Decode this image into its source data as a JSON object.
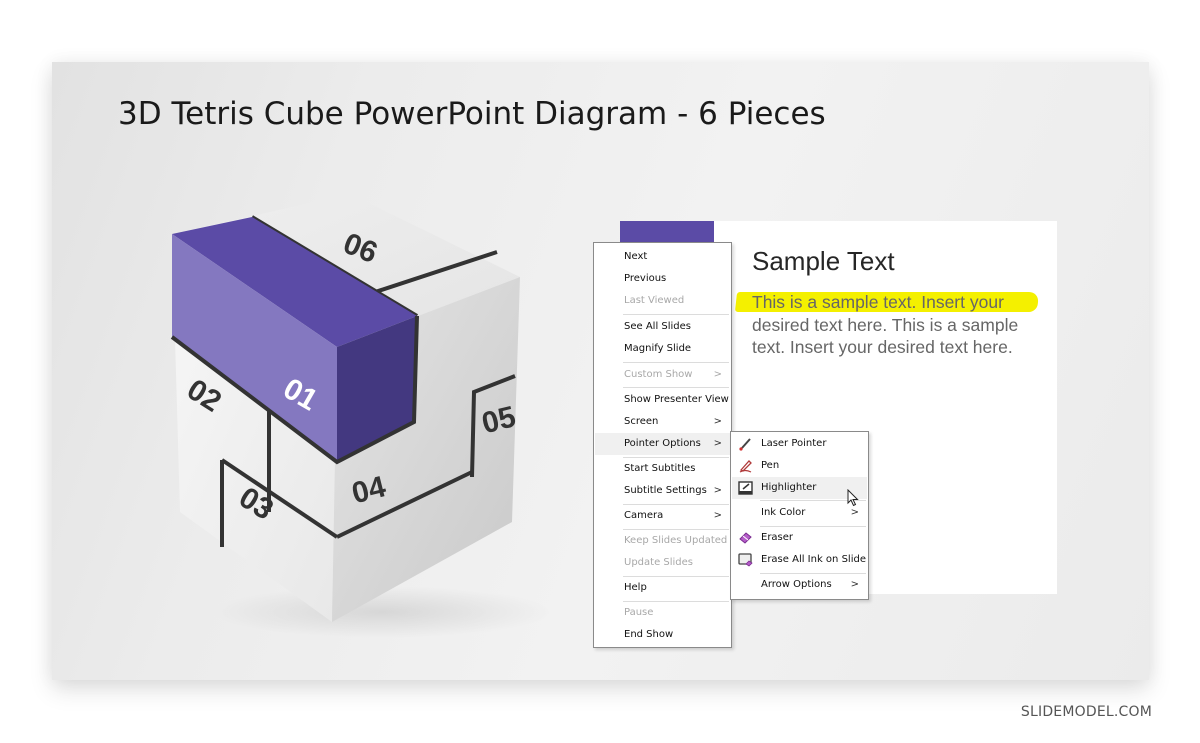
{
  "slide": {
    "title": "3D Tetris Cube PowerPoint Diagram - 6 Pieces",
    "accent_color": "#5b4ba6",
    "cube_pieces": [
      {
        "label": "01",
        "color": "#5b4ba6"
      },
      {
        "label": "02",
        "color": "#eeeeee"
      },
      {
        "label": "03",
        "color": "#eeeeee"
      },
      {
        "label": "04",
        "color": "#eeeeee"
      },
      {
        "label": "05",
        "color": "#eeeeee"
      },
      {
        "label": "06",
        "color": "#eeeeee"
      }
    ],
    "textbox": {
      "heading": "Sample Text",
      "body": "This is a sample text.  Insert your desired text here. This is a sample text.  Insert your desired text here.",
      "highlighted_text": "This is a sample text.  Insert your",
      "highlight_color": "#f4f000"
    }
  },
  "context_menu": {
    "items": [
      {
        "label": "Next",
        "enabled": true
      },
      {
        "label": "Previous",
        "enabled": true
      },
      {
        "label": "Last Viewed",
        "enabled": false
      },
      {
        "label": "See All Slides",
        "enabled": true
      },
      {
        "label": "Magnify Slide",
        "enabled": true
      },
      {
        "label": "Custom Show",
        "enabled": false,
        "submenu": true
      },
      {
        "label": "Show Presenter View",
        "enabled": true
      },
      {
        "label": "Screen",
        "enabled": true,
        "submenu": true
      },
      {
        "label": "Pointer Options",
        "enabled": true,
        "submenu": true,
        "active": true
      },
      {
        "label": "Start Subtitles",
        "enabled": true
      },
      {
        "label": "Subtitle Settings",
        "enabled": true,
        "submenu": true
      },
      {
        "label": "Camera",
        "enabled": true,
        "submenu": true
      },
      {
        "label": "Keep Slides Updated",
        "enabled": false
      },
      {
        "label": "Update Slides",
        "enabled": false
      },
      {
        "label": "Help",
        "enabled": true
      },
      {
        "label": "Pause",
        "enabled": false
      },
      {
        "label": "End Show",
        "enabled": true
      }
    ],
    "arrow_glyph": ">"
  },
  "pointer_submenu": {
    "items": [
      {
        "label": "Laser Pointer",
        "icon": "laser-pointer-icon"
      },
      {
        "label": "Pen",
        "icon": "pen-icon"
      },
      {
        "label": "Highlighter",
        "icon": "highlighter-icon",
        "hovered": true
      },
      {
        "label": "Ink Color",
        "submenu": true
      },
      {
        "label": "Eraser",
        "icon": "eraser-icon"
      },
      {
        "label": "Erase All Ink on Slide",
        "icon": "erase-all-ink-icon"
      },
      {
        "label": "Arrow Options",
        "submenu": true
      }
    ]
  },
  "watermark": "SLIDEMODEL.COM"
}
